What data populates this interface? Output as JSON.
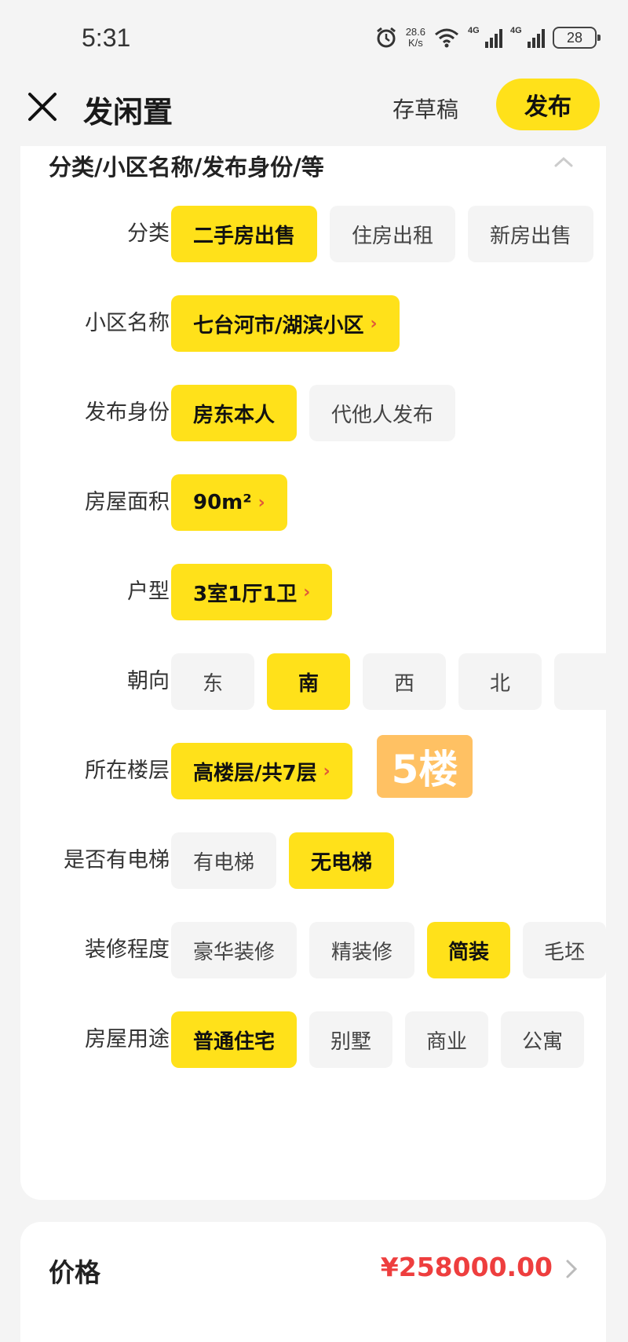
{
  "status_bar": {
    "time": "5:31",
    "speed_value": "28.6",
    "speed_unit": "K/s",
    "net1": "4G",
    "net2": "4G",
    "battery": "28"
  },
  "header": {
    "title": "发闲置",
    "draft_label": "存草稿",
    "publish_label": "发布"
  },
  "section": {
    "title": "分类/小区名称/发布身份/等"
  },
  "rows": {
    "category": {
      "label": "分类",
      "options": [
        "二手房出售",
        "住房出租",
        "新房出售"
      ]
    },
    "community": {
      "label": "小区名称",
      "value": "七台河市/湖滨小区"
    },
    "identity": {
      "label": "发布身份",
      "options": [
        "房东本人",
        "代他人发布"
      ]
    },
    "area": {
      "label": "房屋面积",
      "value": "90m²"
    },
    "layout": {
      "label": "户型",
      "value": "3室1厅1卫"
    },
    "orientation": {
      "label": "朝向",
      "options": [
        "东",
        "南",
        "西",
        "北"
      ]
    },
    "floor": {
      "label": "所在楼层",
      "value": "高楼层/共7层",
      "badge": "5楼"
    },
    "elevator": {
      "label": "是否有电梯",
      "options": [
        "有电梯",
        "无电梯"
      ]
    },
    "decoration": {
      "label": "装修程度",
      "options": [
        "豪华装修",
        "精装修",
        "简装",
        "毛坯"
      ]
    },
    "usage": {
      "label": "房屋用途",
      "options": [
        "普通住宅",
        "别墅",
        "商业",
        "公寓"
      ]
    }
  },
  "price": {
    "label": "价格",
    "value": "¥258000.00"
  },
  "colors": {
    "accent_yellow": "#ffe11a",
    "price_red": "#ee3e3e",
    "badge_orange": "#ffc163"
  }
}
